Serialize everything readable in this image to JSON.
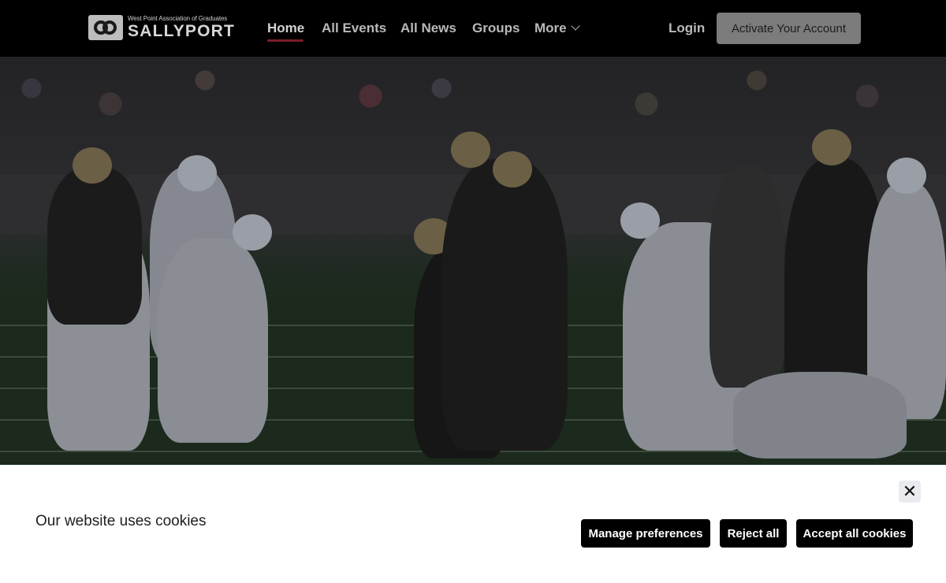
{
  "header": {
    "logo": {
      "small_text": "West Point Association of Graduates",
      "big_text": "SALLYPORT"
    },
    "nav": [
      {
        "label": "Home",
        "active": true
      },
      {
        "label": "All Events",
        "active": false
      },
      {
        "label": "All News",
        "active": false
      },
      {
        "label": "Groups",
        "active": false
      },
      {
        "label": "More",
        "active": false
      }
    ],
    "login_label": "Login",
    "activate_label": "Activate Your Account"
  },
  "hero": {
    "image_description_icon": "football-game-photo"
  },
  "cookie_banner": {
    "title": "Our website uses cookies",
    "close_icon": "close-icon",
    "buttons": {
      "manage": "Manage preferences",
      "reject": "Reject all",
      "accept": "Accept all cookies"
    }
  },
  "colors": {
    "header_bg": "#000000",
    "nav_active_underline": "#7a1e2b",
    "activate_bg": "#7c7c7c",
    "cookie_button_bg": "#000000"
  }
}
